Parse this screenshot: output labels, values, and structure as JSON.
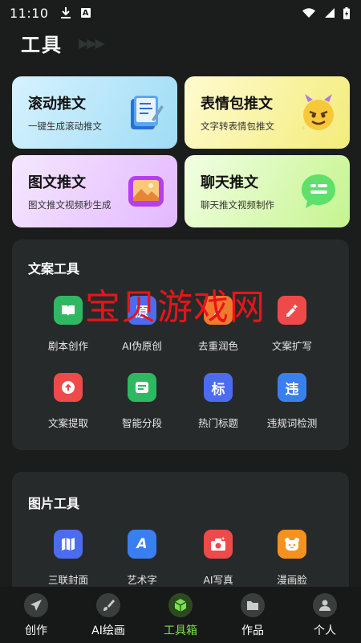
{
  "status": {
    "time": "11:10",
    "a_badge": "A"
  },
  "header": {
    "title": "工具",
    "arrows": "▶▶▶"
  },
  "cards": [
    {
      "title": "滚动推文",
      "subtitle": "一键生成滚动推文",
      "icon": "notebook-icon"
    },
    {
      "title": "表情包推文",
      "subtitle": "文字转表情包推文",
      "icon": "devil-emoji-icon"
    },
    {
      "title": "图文推文",
      "subtitle": "图文推文视频秒生成",
      "icon": "picture-frame-icon"
    },
    {
      "title": "聊天推文",
      "subtitle": "聊天推文视频制作",
      "icon": "chat-bubble-icon"
    }
  ],
  "copy_tools": {
    "title": "文案工具",
    "items": [
      {
        "label": "剧本创作",
        "glyph": "",
        "color": "#2fb862"
      },
      {
        "label": "AI伪原创",
        "glyph": "原",
        "color": "#4c6cf0"
      },
      {
        "label": "去重润色",
        "glyph": "",
        "color": "#f07a2f"
      },
      {
        "label": "文案扩写",
        "glyph": "",
        "color": "#ef4a4a"
      },
      {
        "label": "文案提取",
        "glyph": "",
        "color": "#ef4a4a"
      },
      {
        "label": "智能分段",
        "glyph": "",
        "color": "#2fb862"
      },
      {
        "label": "热门标题",
        "glyph": "标",
        "color": "#4c6cf0"
      },
      {
        "label": "违规词检测",
        "glyph": "违",
        "color": "#3a7ff0"
      }
    ]
  },
  "image_tools": {
    "title": "图片工具",
    "items": [
      {
        "label": "三联封面",
        "glyph": "",
        "color": "#4c6cf0"
      },
      {
        "label": "艺术字",
        "glyph": "A",
        "color": "#3a7ff0"
      },
      {
        "label": "AI写真",
        "glyph": "",
        "color": "#ef4a4a"
      },
      {
        "label": "漫画脸",
        "glyph": "",
        "color": "#f5921f"
      }
    ]
  },
  "watermark": "宝贝游戏网",
  "tabs": [
    {
      "label": "创作",
      "icon": "paper-plane-icon"
    },
    {
      "label": "AI绘画",
      "icon": "brush-icon"
    },
    {
      "label": "工具箱",
      "icon": "cube-icon",
      "active": true
    },
    {
      "label": "作品",
      "icon": "folder-icon"
    },
    {
      "label": "个人",
      "icon": "user-icon"
    }
  ],
  "colors": {
    "background": "#1a1d1c",
    "panel": "#272a2a",
    "accent": "#7be34b"
  }
}
